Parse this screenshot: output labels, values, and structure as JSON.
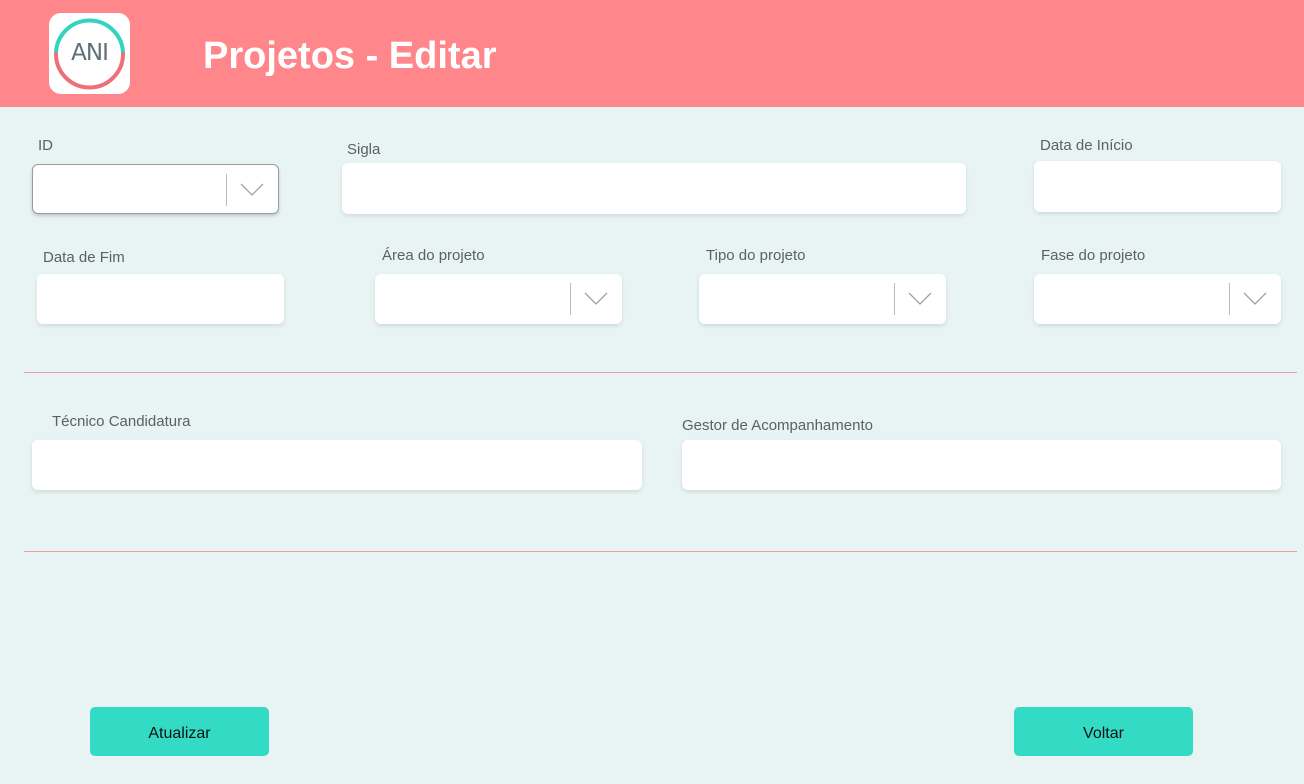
{
  "header": {
    "logo_text": "ANI",
    "title": "Projetos - Editar",
    "background_color": "#ff868b"
  },
  "form": {
    "id": {
      "label": "ID",
      "value": "",
      "icon": "chevron-down-icon"
    },
    "sigla": {
      "label": "Sigla",
      "value": ""
    },
    "data_inicio": {
      "label": "Data de Início",
      "value": ""
    },
    "data_fim": {
      "label": "Data de Fim",
      "value": ""
    },
    "area_projeto": {
      "label": "Área do projeto",
      "value": "",
      "icon": "chevron-down-icon"
    },
    "tipo_projeto": {
      "label": "Tipo do projeto",
      "value": "",
      "icon": "chevron-down-icon"
    },
    "fase_projeto": {
      "label": "Fase do projeto",
      "value": "",
      "icon": "chevron-down-icon"
    },
    "tecnico_candidatura": {
      "label": "Técnico Candidatura",
      "value": ""
    },
    "gestor_acompanhamento": {
      "label": "Gestor de Acompanhamento",
      "value": ""
    }
  },
  "actions": {
    "update_label": "Atualizar",
    "back_label": "Voltar",
    "button_color": "#33dbc5"
  },
  "colors": {
    "page_background": "#e7f4f3",
    "divider": "#ef9a9d"
  }
}
